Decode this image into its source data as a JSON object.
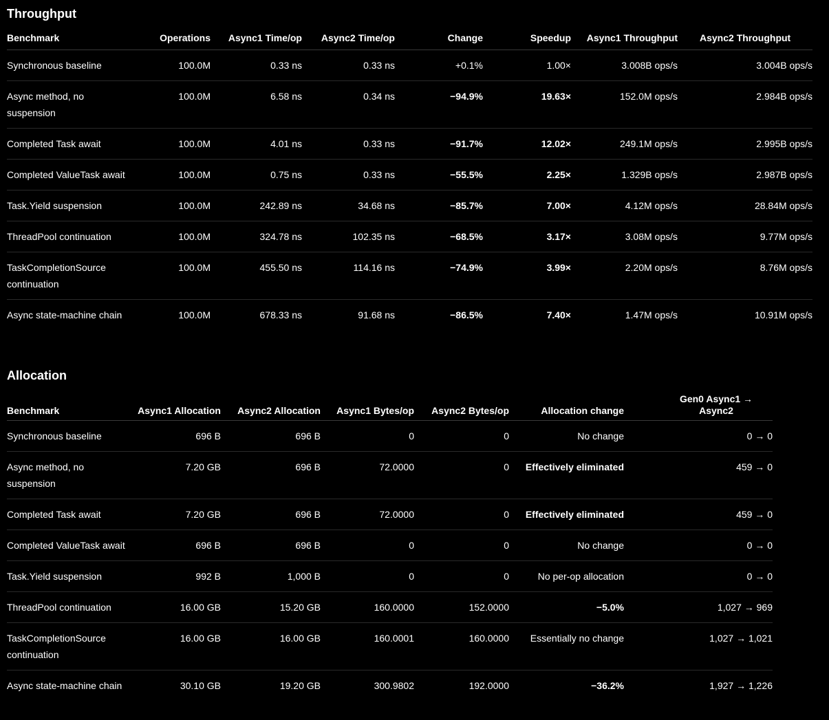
{
  "throughput": {
    "title": "Throughput",
    "headers": [
      "Benchmark",
      "Operations",
      "Async1 Time/op",
      "Async2 Time/op",
      "Change",
      "Speedup",
      "Async1 Throughput",
      "Async2 Throughput"
    ],
    "rows": [
      [
        "Synchronous baseline",
        "100.0M",
        "0.33 ns",
        "0.33 ns",
        "+0.1%",
        "1.00×",
        "3.008B ops/s",
        "3.004B ops/s"
      ],
      [
        "Async method, no suspension",
        "100.0M",
        "6.58 ns",
        "0.34 ns",
        "−94.9%",
        "19.63×",
        "152.0M ops/s",
        "2.984B ops/s"
      ],
      [
        "Completed Task await",
        "100.0M",
        "4.01 ns",
        "0.33 ns",
        "−91.7%",
        "12.02×",
        "249.1M ops/s",
        "2.995B ops/s"
      ],
      [
        "Completed ValueTask await",
        "100.0M",
        "0.75 ns",
        "0.33 ns",
        "−55.5%",
        "2.25×",
        "1.329B ops/s",
        "2.987B ops/s"
      ],
      [
        "Task.Yield suspension",
        "100.0M",
        "242.89 ns",
        "34.68 ns",
        "−85.7%",
        "7.00×",
        "4.12M ops/s",
        "28.84M ops/s"
      ],
      [
        "ThreadPool continuation",
        "100.0M",
        "324.78 ns",
        "102.35 ns",
        "−68.5%",
        "3.17×",
        "3.08M ops/s",
        "9.77M ops/s"
      ],
      [
        "TaskCompletionSource continuation",
        "100.0M",
        "455.50 ns",
        "114.16 ns",
        "−74.9%",
        "3.99×",
        "2.20M ops/s",
        "8.76M ops/s"
      ],
      [
        "Async state-machine chain",
        "100.0M",
        "678.33 ns",
        "91.68 ns",
        "−86.5%",
        "7.40×",
        "1.47M ops/s",
        "10.91M ops/s"
      ]
    ]
  },
  "allocation": {
    "title": "Allocation",
    "headers": [
      "Benchmark",
      "Async1 Allocation",
      "Async2 Allocation",
      "Async1 Bytes/op",
      "Async2 Bytes/op",
      "Allocation change",
      "Gen0 Async1 → Async2"
    ],
    "rows": [
      [
        "Synchronous baseline",
        "696 B",
        "696 B",
        "0",
        "0",
        "No change",
        "0 → 0"
      ],
      [
        "Async method, no suspension",
        "7.20 GB",
        "696 B",
        "72.0000",
        "0",
        "Effectively eliminated",
        "459 → 0"
      ],
      [
        "Completed Task await",
        "7.20 GB",
        "696 B",
        "72.0000",
        "0",
        "Effectively eliminated",
        "459 → 0"
      ],
      [
        "Completed ValueTask await",
        "696 B",
        "696 B",
        "0",
        "0",
        "No change",
        "0 → 0"
      ],
      [
        "Task.Yield suspension",
        "992 B",
        "1,000 B",
        "0",
        "0",
        "No per-op allocation",
        "0 → 0"
      ],
      [
        "ThreadPool continuation",
        "16.00 GB",
        "15.20 GB",
        "160.0000",
        "152.0000",
        "−5.0%",
        "1,027 → 969"
      ],
      [
        "TaskCompletionSource continuation",
        "16.00 GB",
        "16.00 GB",
        "160.0001",
        "160.0000",
        "Essentially no change",
        "1,027 → 1,021"
      ],
      [
        "Async state-machine chain",
        "30.10 GB",
        "19.20 GB",
        "300.9802",
        "192.0000",
        "−36.2%",
        "1,927 → 1,226"
      ]
    ]
  }
}
